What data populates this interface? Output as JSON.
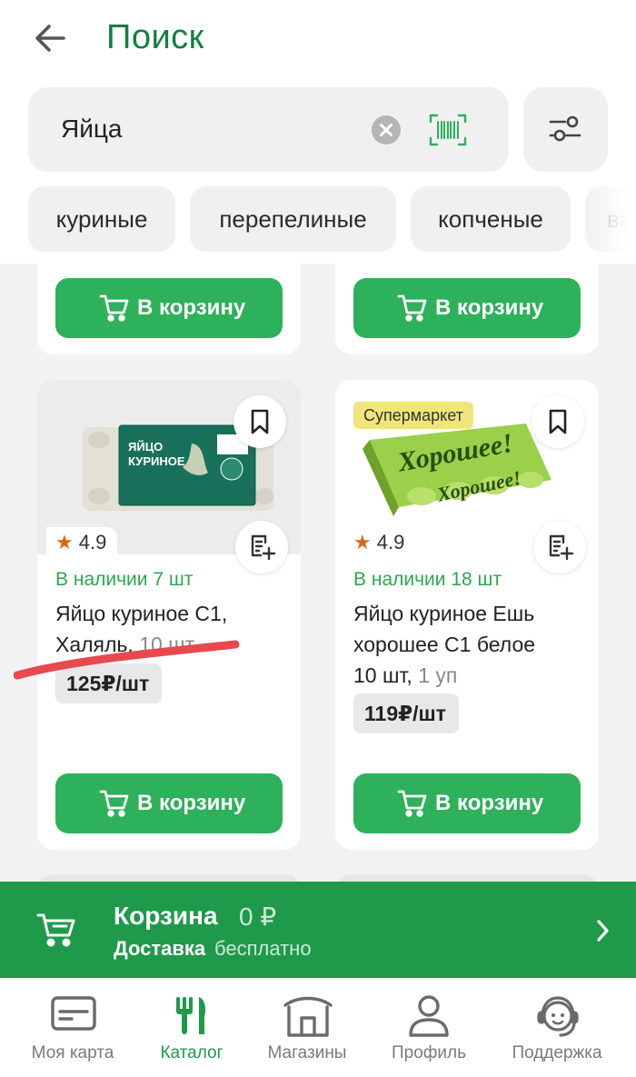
{
  "header": {
    "title": "Поиск"
  },
  "search": {
    "value": "Яйца"
  },
  "chips": [
    "куриные",
    "перепелиные",
    "копченые",
    "ва"
  ],
  "card_action_label": "В корзину",
  "products": [
    {
      "rating": "4.9",
      "stock": "В наличии 7 шт",
      "name_line1": "Яйцо куриное С1,",
      "name_line2": "Халяль,",
      "qty": "10 шт",
      "price": "125₽/шт",
      "package_text": "ЯЙЦО КУРИНОЕ",
      "colors": {
        "package": "#19705a"
      }
    },
    {
      "badge": "Супермаркет",
      "rating": "4.9",
      "stock": "В наличии 18 шт",
      "name_line1": "Яйцо куриное Ешь",
      "name_line2": "хорошее С1 белое",
      "name_line3": "10 шт,",
      "qty": "1 уп",
      "price": "119₽/шт",
      "package_text": "Хорошее!",
      "colors": {
        "package": "#8cc63f"
      }
    }
  ],
  "cart_bar": {
    "title": "Корзина",
    "amount": "0 ₽",
    "delivery_label": "Доставка",
    "delivery_value": "бесплатно"
  },
  "tabs": [
    {
      "label": "Моя карта",
      "icon": "card-icon",
      "active": false
    },
    {
      "label": "Каталог",
      "icon": "cutlery-icon",
      "active": true
    },
    {
      "label": "Магазины",
      "icon": "store-icon",
      "active": false
    },
    {
      "label": "Профиль",
      "icon": "profile-icon",
      "active": false
    },
    {
      "label": "Поддержка",
      "icon": "support-icon",
      "active": false
    }
  ],
  "colors": {
    "brand_green": "#1f9a4a",
    "button_green": "#2db15a",
    "title_green": "#12803f",
    "stock_green": "#2aa84e",
    "badge_yellow": "#efe67a",
    "rating_star": "#d46a18",
    "scribble_red": "#e8484f"
  }
}
